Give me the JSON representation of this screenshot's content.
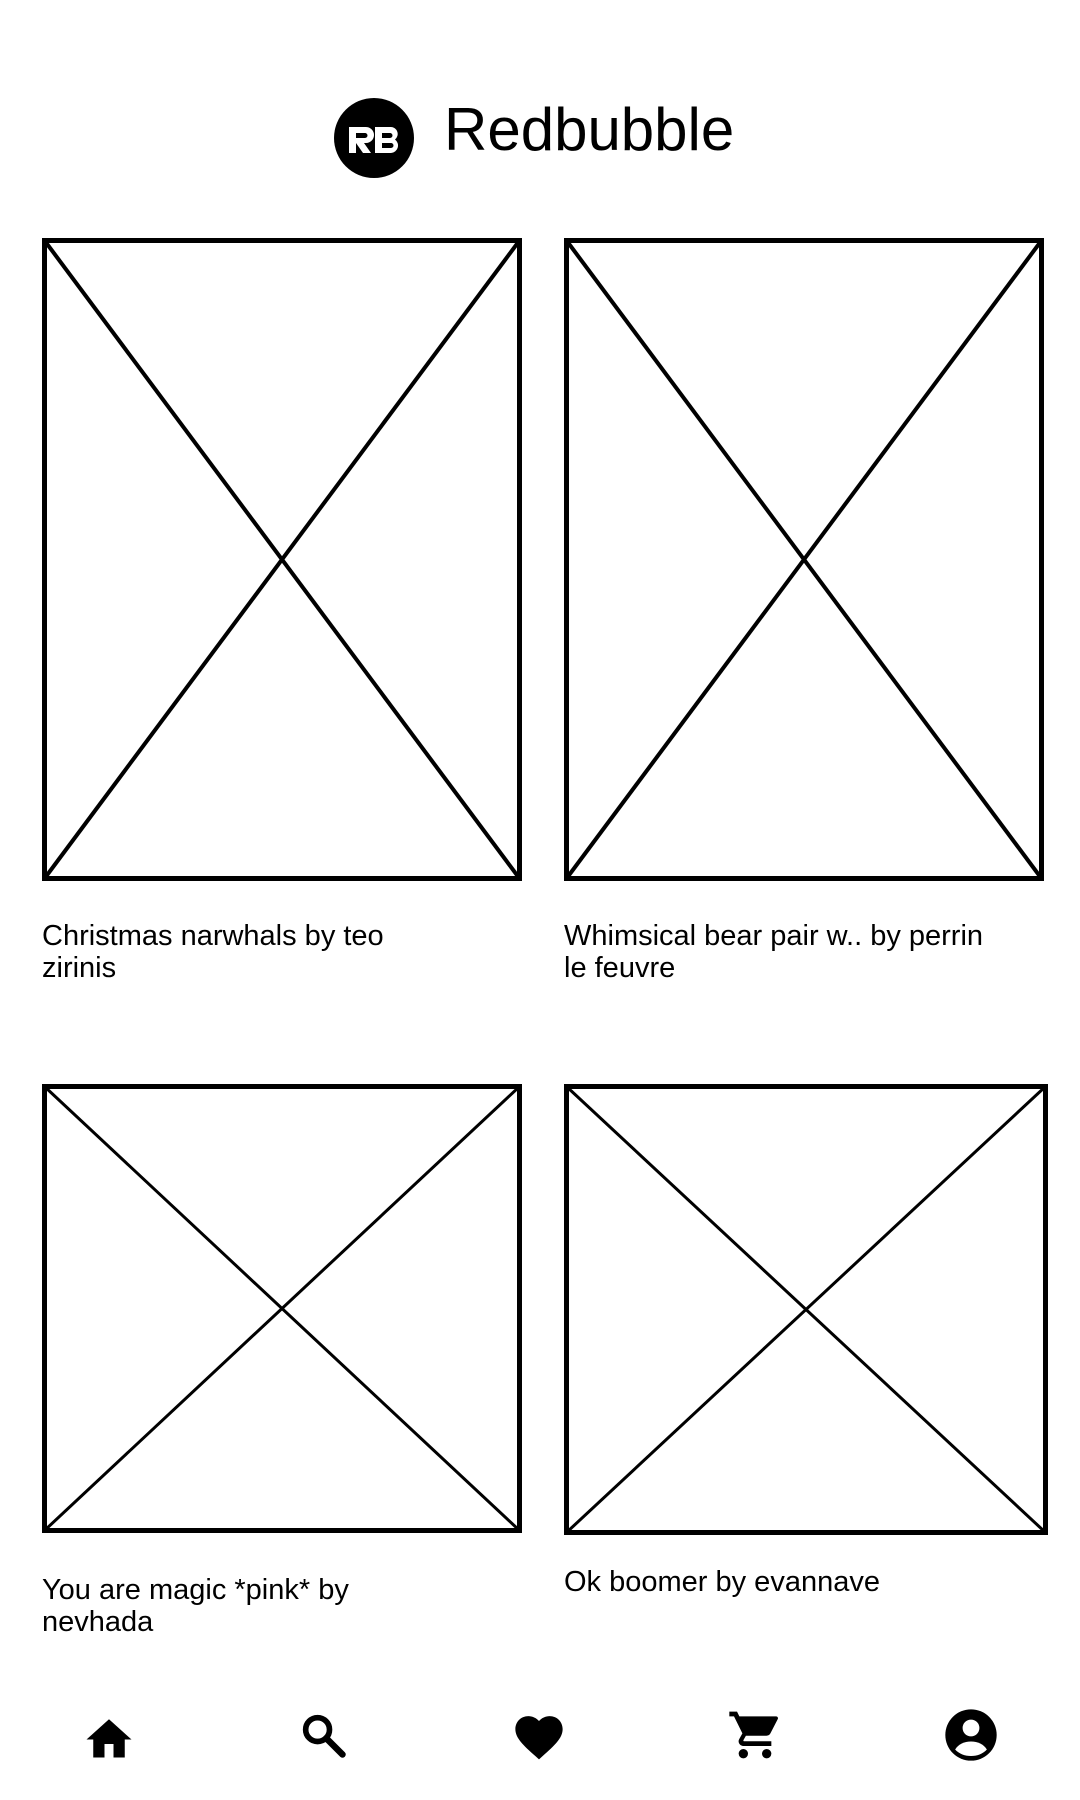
{
  "app": {
    "brand_name": "Redbubble",
    "logo_icon": "redbubble-logo-icon"
  },
  "products": [
    {
      "caption": "Christmas narwhals by teo zirinis",
      "image": "image-placeholder-icon"
    },
    {
      "caption": "Whimsical bear pair w.. by perrin le feuvre",
      "image": "image-placeholder-icon"
    },
    {
      "caption": "You are magic *pink* by nevhada",
      "image": "image-placeholder-icon"
    },
    {
      "caption": "Ok boomer by evannave",
      "image": "image-placeholder-icon"
    }
  ],
  "bottom_nav": [
    {
      "name": "home",
      "icon": "home-icon"
    },
    {
      "name": "search",
      "icon": "search-icon"
    },
    {
      "name": "favorites",
      "icon": "heart-icon"
    },
    {
      "name": "cart",
      "icon": "cart-icon"
    },
    {
      "name": "account",
      "icon": "account-circle-icon"
    }
  ],
  "colors": {
    "background": "#ffffff",
    "foreground": "#000000"
  }
}
